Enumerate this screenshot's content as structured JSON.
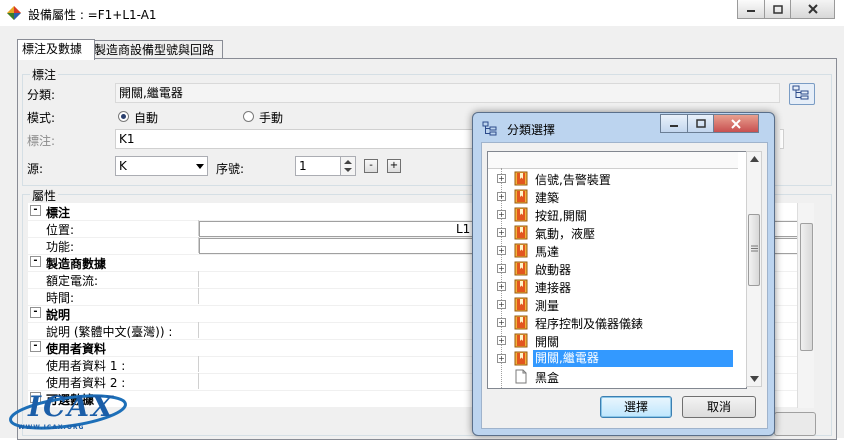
{
  "window": {
    "title": "設備屬性 : =F1+L1-A1"
  },
  "tabs": [
    {
      "label": "標注及數據"
    },
    {
      "label": "製造商設備型號與回路"
    }
  ],
  "annotation": {
    "group_title": "標注",
    "category_label": "分類:",
    "category_value": "開關,繼電器",
    "mode_label": "模式:",
    "mode_auto": "自動",
    "mode_manual": "手動",
    "mode_selected": "自動",
    "tag_label": "標注:",
    "tag_value": "K1",
    "source_label": "源:",
    "source_value": "K",
    "seq_label": "序號:",
    "seq_value": "1",
    "minus": "-",
    "plus": "+"
  },
  "properties": {
    "group_title": "屬性",
    "rows": [
      {
        "kind": "cat",
        "name": "標注"
      },
      {
        "kind": "prop",
        "name": "位置:",
        "value": "L1 -"
      },
      {
        "kind": "prop",
        "name": "功能:",
        "value": ""
      },
      {
        "kind": "cat",
        "name": "製造商數據"
      },
      {
        "kind": "prop",
        "name": "額定電流:",
        "value": ""
      },
      {
        "kind": "prop",
        "name": "時間:",
        "value": ""
      },
      {
        "kind": "cat",
        "name": "說明"
      },
      {
        "kind": "prop",
        "name": "說明 (繁體中文(臺灣)) :",
        "value": ""
      },
      {
        "kind": "cat",
        "name": "使用者資料"
      },
      {
        "kind": "prop",
        "name": "使用者資料 1 :",
        "value": ""
      },
      {
        "kind": "prop",
        "name": "使用者資料 2 :",
        "value": ""
      },
      {
        "kind": "cat",
        "name": "可選數據"
      }
    ]
  },
  "dialog": {
    "title": "分類選擇",
    "items": [
      {
        "label": "信號,告警裝置",
        "expandable": true
      },
      {
        "label": "建築",
        "expandable": true
      },
      {
        "label": "按鈕,開關",
        "expandable": true
      },
      {
        "label": "氣動，液壓",
        "expandable": true
      },
      {
        "label": "馬達",
        "expandable": true
      },
      {
        "label": "啟動器",
        "expandable": true
      },
      {
        "label": "連接器",
        "expandable": true
      },
      {
        "label": "測量",
        "expandable": true
      },
      {
        "label": "程序控制及儀器儀錶",
        "expandable": true
      },
      {
        "label": "開關",
        "expandable": true
      },
      {
        "label": "開關,繼電器",
        "expandable": true,
        "selected": true
      },
      {
        "label": "黑盒",
        "expandable": false
      }
    ],
    "ok_label": "選擇",
    "cancel_label": "取消"
  },
  "watermark": {
    "text": "ICAX",
    "subtext": "WWW.ICAX.ORG"
  },
  "colors": {
    "selection": "#3399ff",
    "dialog_frame": "#bcd4ef",
    "close_button": "#c75050"
  }
}
